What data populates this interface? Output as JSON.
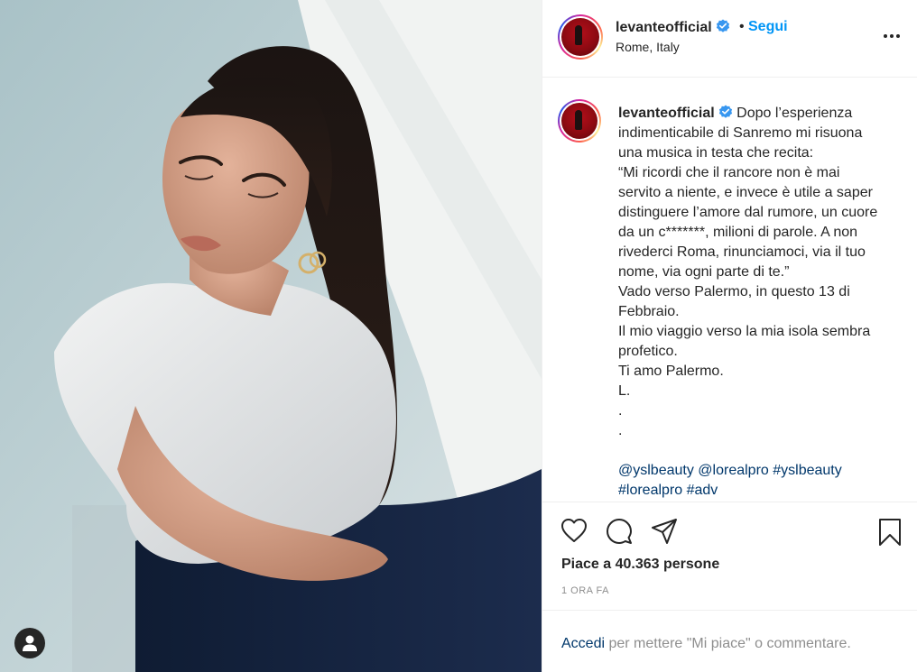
{
  "post": {
    "username": "levanteofficial",
    "follow_label": "Segui",
    "separator": "•",
    "location": "Rome, Italy",
    "caption_lines": [
      "Dopo l’esperienza",
      "indimenticabile di Sanremo mi risuona",
      "una musica in testa che recita:",
      "“Mi ricordi che il rancore non è mai",
      "servito a niente, e invece è utile a saper",
      "distinguere l’amore dal rumore, un cuore",
      "da un c*******, milioni di parole. A non",
      "rivederci Roma, rinunciamoci, via il tuo",
      "nome, via ogni parte di te.”",
      "Vado verso Palermo, in questo 13 di",
      "Febbraio.",
      "Il mio viaggio verso la mia isola sembra",
      "profetico.",
      "Ti amo Palermo.",
      "L.",
      ".",
      "."
    ],
    "hashtags": [
      "@yslbeauty",
      "@lorealpro",
      "#yslbeauty",
      "#lorealpro",
      "#adv"
    ],
    "likes_text": "Piace a 40.363 persone",
    "time_ago": "1 ORA FA",
    "login_link": "Accedi",
    "login_rest": " per mettere \"Mi piace\" o commentare."
  },
  "icons": {
    "verified": "verified-badge-icon",
    "more": "more-options-icon",
    "like": "heart-icon",
    "comment": "comment-icon",
    "share": "share-icon",
    "save": "bookmark-icon",
    "user_tag": "user-tag-icon"
  },
  "colors": {
    "link_blue": "#0095f6",
    "hashtag_blue": "#00376b",
    "text": "#262626",
    "muted": "#8e8e8e"
  }
}
